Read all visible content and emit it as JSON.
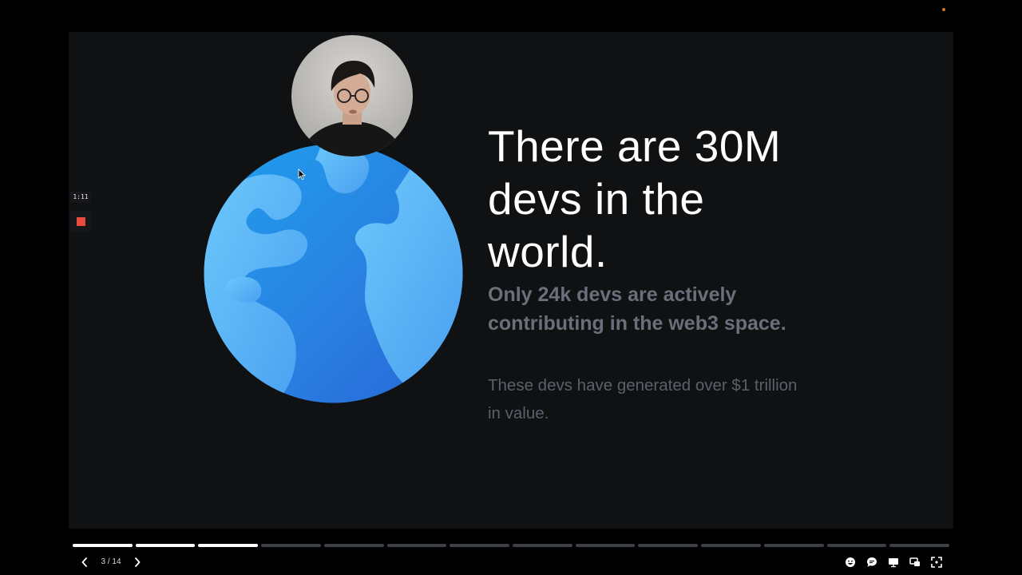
{
  "recording": {
    "timer": "1:11"
  },
  "slide": {
    "headline": "There are 30M devs in the world.",
    "subheadline": "Only 24k devs are actively contributing in the web3 space.",
    "body": "These devs have generated over $1 trillion in value."
  },
  "player": {
    "page_counter": "3 / 14",
    "total_slides": 14,
    "current_slide": 3
  },
  "colors": {
    "slide_background": "#0f1113",
    "headline": "#ffffff",
    "subheadline": "#6b6f7a",
    "body": "#5b606b",
    "stop_red": "#e64b3c",
    "progress_done": "#ffffff",
    "progress_pending": "#3d4046"
  },
  "icons": {
    "prev": "chevron-left-icon",
    "next": "chevron-right-icon",
    "reactions": "emoji-icon",
    "comments": "comment-icon",
    "present": "presentation-icon",
    "pip": "picture-in-picture-icon",
    "fullscreen": "fullscreen-icon"
  }
}
